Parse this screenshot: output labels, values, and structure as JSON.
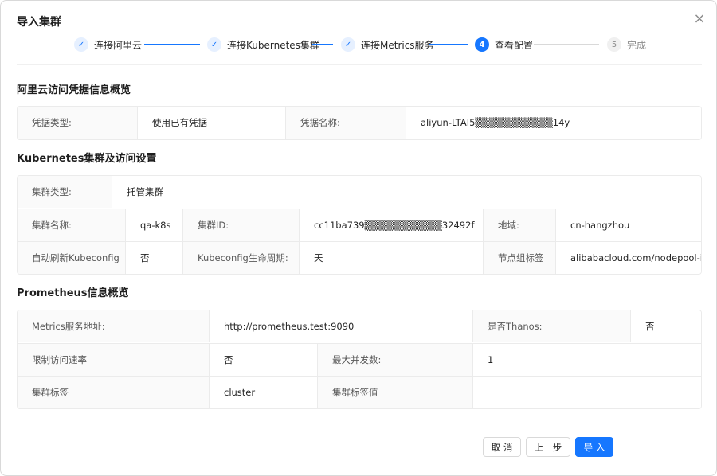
{
  "dialog": {
    "title": "导入集群",
    "close_icon": "×"
  },
  "steps": [
    {
      "label": "连接阿里云",
      "status": "done",
      "marker": "✓"
    },
    {
      "label": "连接Kubernetes集群",
      "status": "done",
      "marker": "✓"
    },
    {
      "label": "连接Metrics服务",
      "status": "done",
      "marker": "✓"
    },
    {
      "label": "查看配置",
      "status": "active",
      "marker": "4"
    },
    {
      "label": "完成",
      "status": "todo",
      "marker": "5"
    }
  ],
  "credentials": {
    "section_title": "阿里云访问凭据信息概览",
    "type_label": "凭据类型:",
    "type_value": "使用已有凭据",
    "name_label": "凭据名称:",
    "name_value": "aliyun-LTAI5▒▒▒▒▒▒▒▒▒▒▒14y"
  },
  "kubernetes": {
    "section_title": "Kubernetes集群及访问设置",
    "cluster_type_label": "集群类型:",
    "cluster_type_value": "托管集群",
    "cluster_name_label": "集群名称:",
    "cluster_name_value": "qa-k8s",
    "cluster_id_label": "集群ID:",
    "cluster_id_value": "cc11ba739▒▒▒▒▒▒▒▒▒▒▒32492f",
    "region_label": "地域:",
    "region_value": "cn-hangzhou",
    "auto_refresh_label": "自动刷新Kubeconfig",
    "auto_refresh_value": "否",
    "lifecycle_label": "Kubeconfig生命周期:",
    "lifecycle_value": "天",
    "nodepool_label": "节点组标签",
    "nodepool_value": "alibabacloud.com/nodepool-id"
  },
  "prometheus": {
    "section_title": "Prometheus信息概览",
    "metrics_url_label": "Metrics服务地址:",
    "metrics_url_value": "http://prometheus.test:9090",
    "thanos_label": "是否Thanos:",
    "thanos_value": "否",
    "rate_limit_label": "限制访问速率",
    "rate_limit_value": "否",
    "max_concurrency_label": "最大并发数:",
    "max_concurrency_value": "1",
    "cluster_label_label": "集群标签",
    "cluster_label_value": "cluster",
    "cluster_label_value_label": "集群标签值",
    "cluster_label_value_value": ""
  },
  "footer": {
    "cancel_label": "取 消",
    "prev_label": "上一步",
    "import_label": "导 入"
  },
  "colors": {
    "primary": "#1677ff",
    "label_bg": "#fafafa",
    "border": "#ebebeb"
  }
}
